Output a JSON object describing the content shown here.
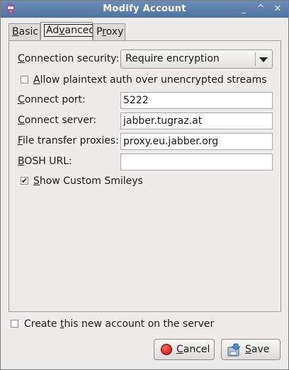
{
  "window": {
    "title": "Modify Account",
    "controls": {
      "minimize": "_",
      "maximize": "^",
      "close": "✕"
    }
  },
  "tabs": [
    {
      "label_pre": "",
      "label_u": "B",
      "label_post": "asic"
    },
    {
      "label_pre": "Ad",
      "label_u": "v",
      "label_post": "anced"
    },
    {
      "label_pre": "P",
      "label_u": "r",
      "label_post": "oxy"
    }
  ],
  "advanced": {
    "connection_security": {
      "label_u": "C",
      "label_post": "onnection security:",
      "value": "Require encryption"
    },
    "plaintext_auth": {
      "label_u": "A",
      "label_post": "llow plaintext auth over unencrypted streams",
      "checked": false
    },
    "connect_port": {
      "label_u": "C",
      "label_post": "onnect port:",
      "value": "5222"
    },
    "connect_server": {
      "label_u": "C",
      "label_post": "onnect server:",
      "value": "jabber.tugraz.at"
    },
    "file_transfer_proxies": {
      "label_u": "F",
      "label_post": "ile transfer proxies:",
      "value": "proxy.eu.jabber.org"
    },
    "bosh_url": {
      "label_u": "B",
      "label_post": "OSH URL:",
      "value": ""
    },
    "show_custom_smileys": {
      "label_u": "S",
      "label_post": "how Custom Smileys",
      "checked": true,
      "check_glyph": "✔"
    }
  },
  "create_account": {
    "label_pre": "Create ",
    "label_u": "t",
    "label_post": "his new account on the server",
    "checked": false
  },
  "buttons": {
    "cancel": {
      "label_u": "C",
      "label_post": "ancel"
    },
    "save": {
      "label_u": "S",
      "label_post": "ave"
    }
  }
}
